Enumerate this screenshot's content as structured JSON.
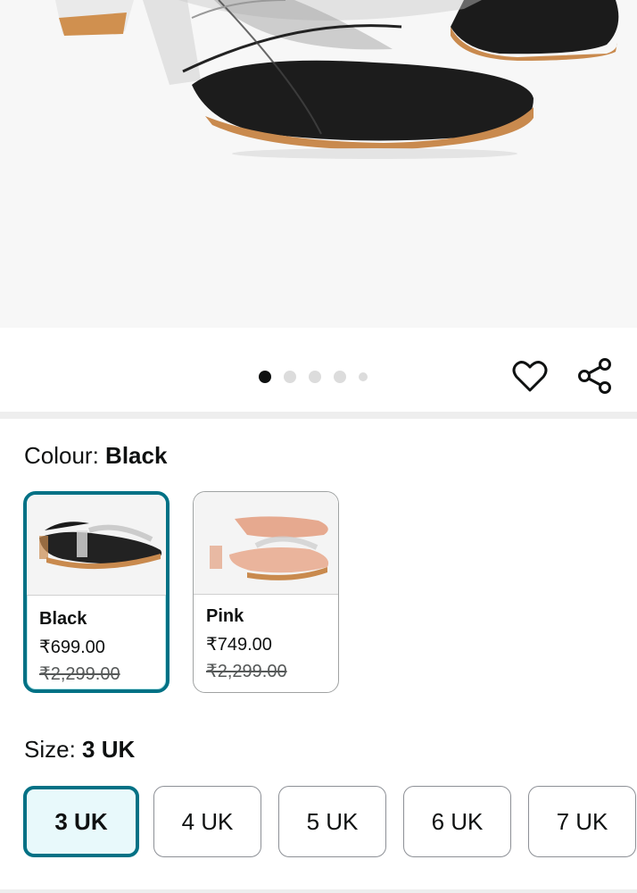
{
  "product_image": {
    "alt": "Black transparent strap block heel sandal"
  },
  "carousel": {
    "total": 5,
    "active_index": 0
  },
  "actions": {
    "wishlist_icon": "heart-outline-icon",
    "share_icon": "share-icon"
  },
  "colour": {
    "label": "Colour: ",
    "selected": "Black",
    "options": [
      {
        "name": "Black",
        "price": "₹699.00",
        "mrp": "₹2,299.00",
        "selected": true
      },
      {
        "name": "Pink",
        "price": "₹749.00",
        "mrp": "₹2,299.00",
        "selected": false
      }
    ]
  },
  "size": {
    "label": "Size: ",
    "selected": "3 UK",
    "options": [
      "3 UK",
      "4 UK",
      "5 UK",
      "6 UK",
      "7 UK"
    ]
  },
  "colors": {
    "accent": "#007185",
    "selected_bg": "#e8f9fb"
  }
}
